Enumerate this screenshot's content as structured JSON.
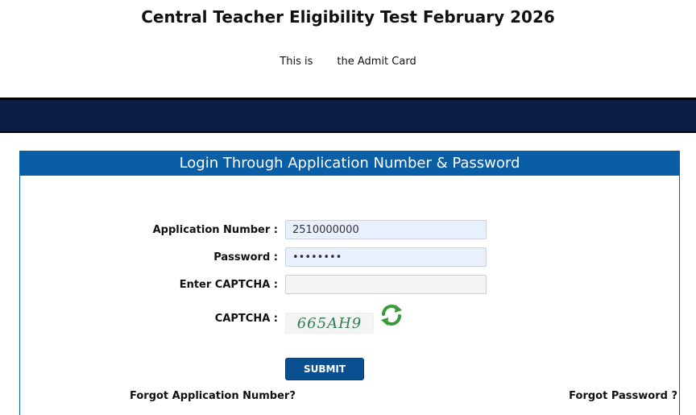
{
  "header": {
    "title": "Central Teacher Eligibility Test February 2026",
    "subtitle_left": "This is",
    "subtitle_right": "the Admit Card"
  },
  "panel": {
    "title": "Login Through Application Number & Password"
  },
  "form": {
    "application_number": {
      "label": "Application Number :",
      "value": "2510000000"
    },
    "password": {
      "label": "Password :",
      "value": "••••••••"
    },
    "captcha_entry": {
      "label": "Enter CAPTCHA :",
      "value": ""
    },
    "captcha": {
      "label": "CAPTCHA :",
      "text": "665AH9"
    },
    "submit_label": "SUBMIT"
  },
  "links": {
    "forgot_application": "Forgot Application Number?",
    "forgot_password": "Forgot Password ?"
  },
  "colors": {
    "nav_band": "#0b1f45",
    "panel_header": "#0a5ea6",
    "submit": "#0a4f8f",
    "refresh_icon": "#3a9a3a"
  },
  "icons": {
    "refresh": "refresh-icon"
  }
}
